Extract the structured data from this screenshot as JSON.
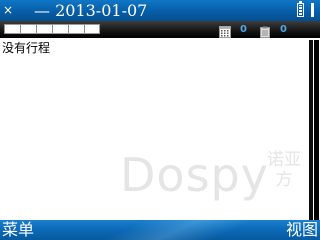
{
  "title_bar": {
    "close_glyph": "×",
    "date_text": "— 2013-01-07",
    "signal_icon": "signal-strength-icon",
    "battery_icon": "battery-icon",
    "battery_level": 1.0
  },
  "toolbar": {
    "progress_icon": "date-strip-indicator",
    "calendar_icon": "calendar-grid-icon",
    "calendar_count": "0",
    "note_icon": "memo-icon",
    "note_count": "0"
  },
  "content": {
    "empty_message": "没有行程"
  },
  "watermark": {
    "brand": "Dospy",
    "cjk": "诺亚方"
  },
  "softkeys": {
    "left": "菜单",
    "right": "视图"
  },
  "colors": {
    "title_bar": "#075ea8",
    "softkey_bar": "#0b69b6",
    "count_text": "#4ea6e6"
  }
}
